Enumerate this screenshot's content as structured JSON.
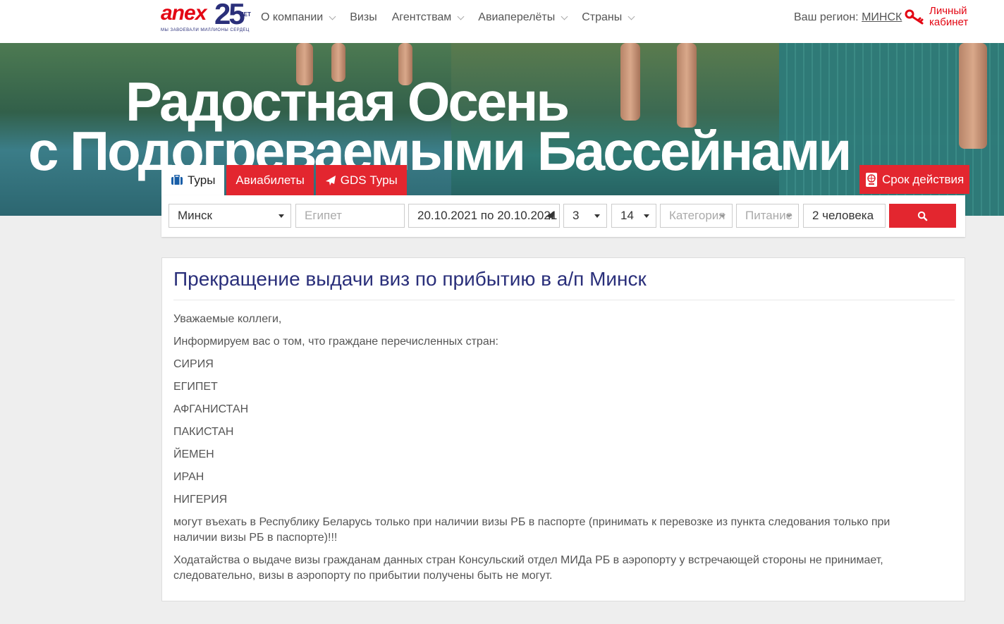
{
  "header": {
    "logo": {
      "word": "anex",
      "number": "25",
      "suffix": "ЛЕТ",
      "tagline": "МЫ ЗАВОЕВАЛИ МИЛЛИОНЫ СЕРДЕЦ"
    },
    "nav": [
      {
        "label": "О компании",
        "dropdown": true
      },
      {
        "label": "Визы",
        "dropdown": false
      },
      {
        "label": "Агентствам",
        "dropdown": true
      },
      {
        "label": "Авиаперелёты",
        "dropdown": true
      },
      {
        "label": "Страны",
        "dropdown": true
      }
    ],
    "region_label": "Ваш регион:",
    "region_value": "МИНСК",
    "cabinet_line1": "Личный",
    "cabinet_line2": "кабинет",
    "accent": "#e30613"
  },
  "banner": {
    "line1": "Радостная Осень",
    "line2": "с Подогреваемыми Бассейнами"
  },
  "search": {
    "tabs": [
      {
        "label": "Туры",
        "icon": "suitcase-icon",
        "active": true
      },
      {
        "label": "Авиабилеты",
        "icon": "",
        "active": false
      },
      {
        "label": "GDS Туры",
        "icon": "plane-icon",
        "active": false
      }
    ],
    "validity_label": "Срок действия",
    "departure": "Минск",
    "destination_placeholder": "Египет",
    "dates": "20.10.2021 по 20.10.2021",
    "nights_from": "3",
    "nights_to": "14",
    "category_placeholder": "Категория",
    "meal_placeholder": "Питание",
    "tourists": "2 человека",
    "button_color": "#e3262f"
  },
  "article": {
    "title": "Прекращение выдачи виз по прибытию в а/п Минск",
    "paragraphs": [
      "Уважаемые коллеги,",
      "Информируем вас о том, что граждане перечисленных стран:",
      "СИРИЯ",
      "ЕГИПЕТ",
      "АФГАНИСТАН",
      "ПАКИСТАН",
      "ЙЕМЕН",
      "ИРАН",
      "НИГЕРИЯ",
      "могут въехать в Республику Беларусь только при наличии визы РБ в паспорте (принимать к перевозке  из пункта следования только при наличии визы РБ в паспорте)!!!",
      "Ходатайства о выдаче визы гражданам данных стран Консульский отдел МИДа РБ в аэропорту у встречающей стороны не принимает, следовательно, визы в аэропорту по прибытии получены быть не могут."
    ],
    "title_color": "#2a2f7a"
  }
}
